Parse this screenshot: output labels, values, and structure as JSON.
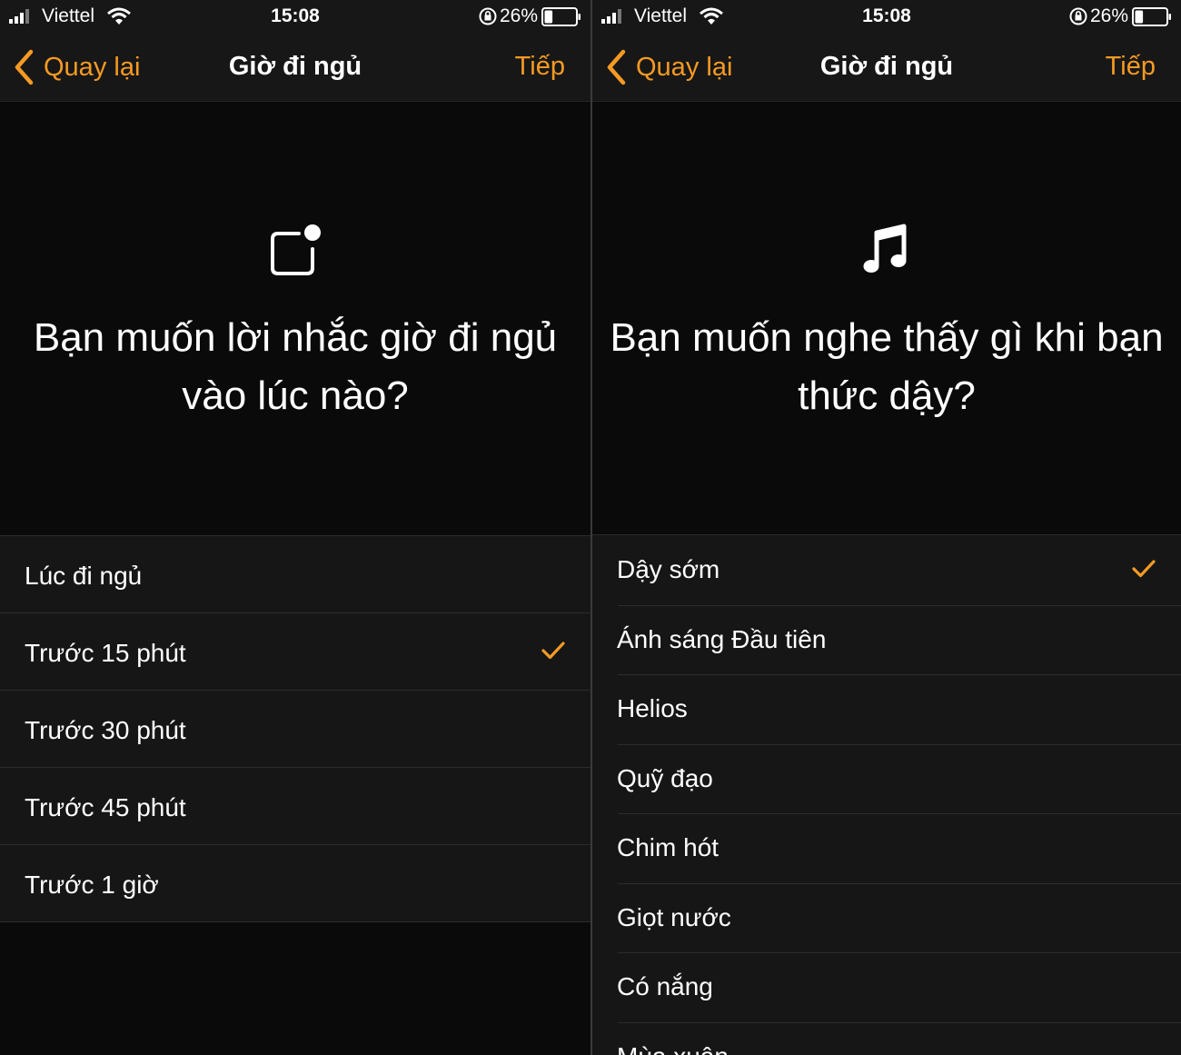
{
  "status_bar": {
    "carrier": "Viettel",
    "time": "15:08",
    "battery_percent": "26%",
    "battery_level": 0.26
  },
  "left_screen": {
    "nav": {
      "back_label": "Quay lại",
      "title": "Giờ đi ngủ",
      "next_label": "Tiếp"
    },
    "icon": "notification-badge-icon",
    "question": "Bạn muốn lời nhắc giờ đi ngủ vào lúc nào?",
    "options": [
      {
        "label": "Lúc đi ngủ",
        "selected": false
      },
      {
        "label": "Trước 15 phút",
        "selected": true
      },
      {
        "label": "Trước 30 phút",
        "selected": false
      },
      {
        "label": "Trước 45 phút",
        "selected": false
      },
      {
        "label": "Trước 1 giờ",
        "selected": false
      }
    ]
  },
  "right_screen": {
    "nav": {
      "back_label": "Quay lại",
      "title": "Giờ đi ngủ",
      "next_label": "Tiếp"
    },
    "icon": "music-note-icon",
    "question": "Bạn muốn nghe thấy gì khi bạn thức dậy?",
    "options": [
      {
        "label": "Dậy sớm",
        "selected": true
      },
      {
        "label": "Ánh sáng Đầu tiên",
        "selected": false
      },
      {
        "label": "Helios",
        "selected": false
      },
      {
        "label": "Quỹ đạo",
        "selected": false
      },
      {
        "label": "Chim hót",
        "selected": false
      },
      {
        "label": "Giọt nước",
        "selected": false
      },
      {
        "label": "Có nắng",
        "selected": false
      },
      {
        "label": "Mùa xuân",
        "selected": false
      }
    ]
  },
  "colors": {
    "accent": "#f59a23",
    "background": "#0a0a0a",
    "list_background": "#161616"
  }
}
